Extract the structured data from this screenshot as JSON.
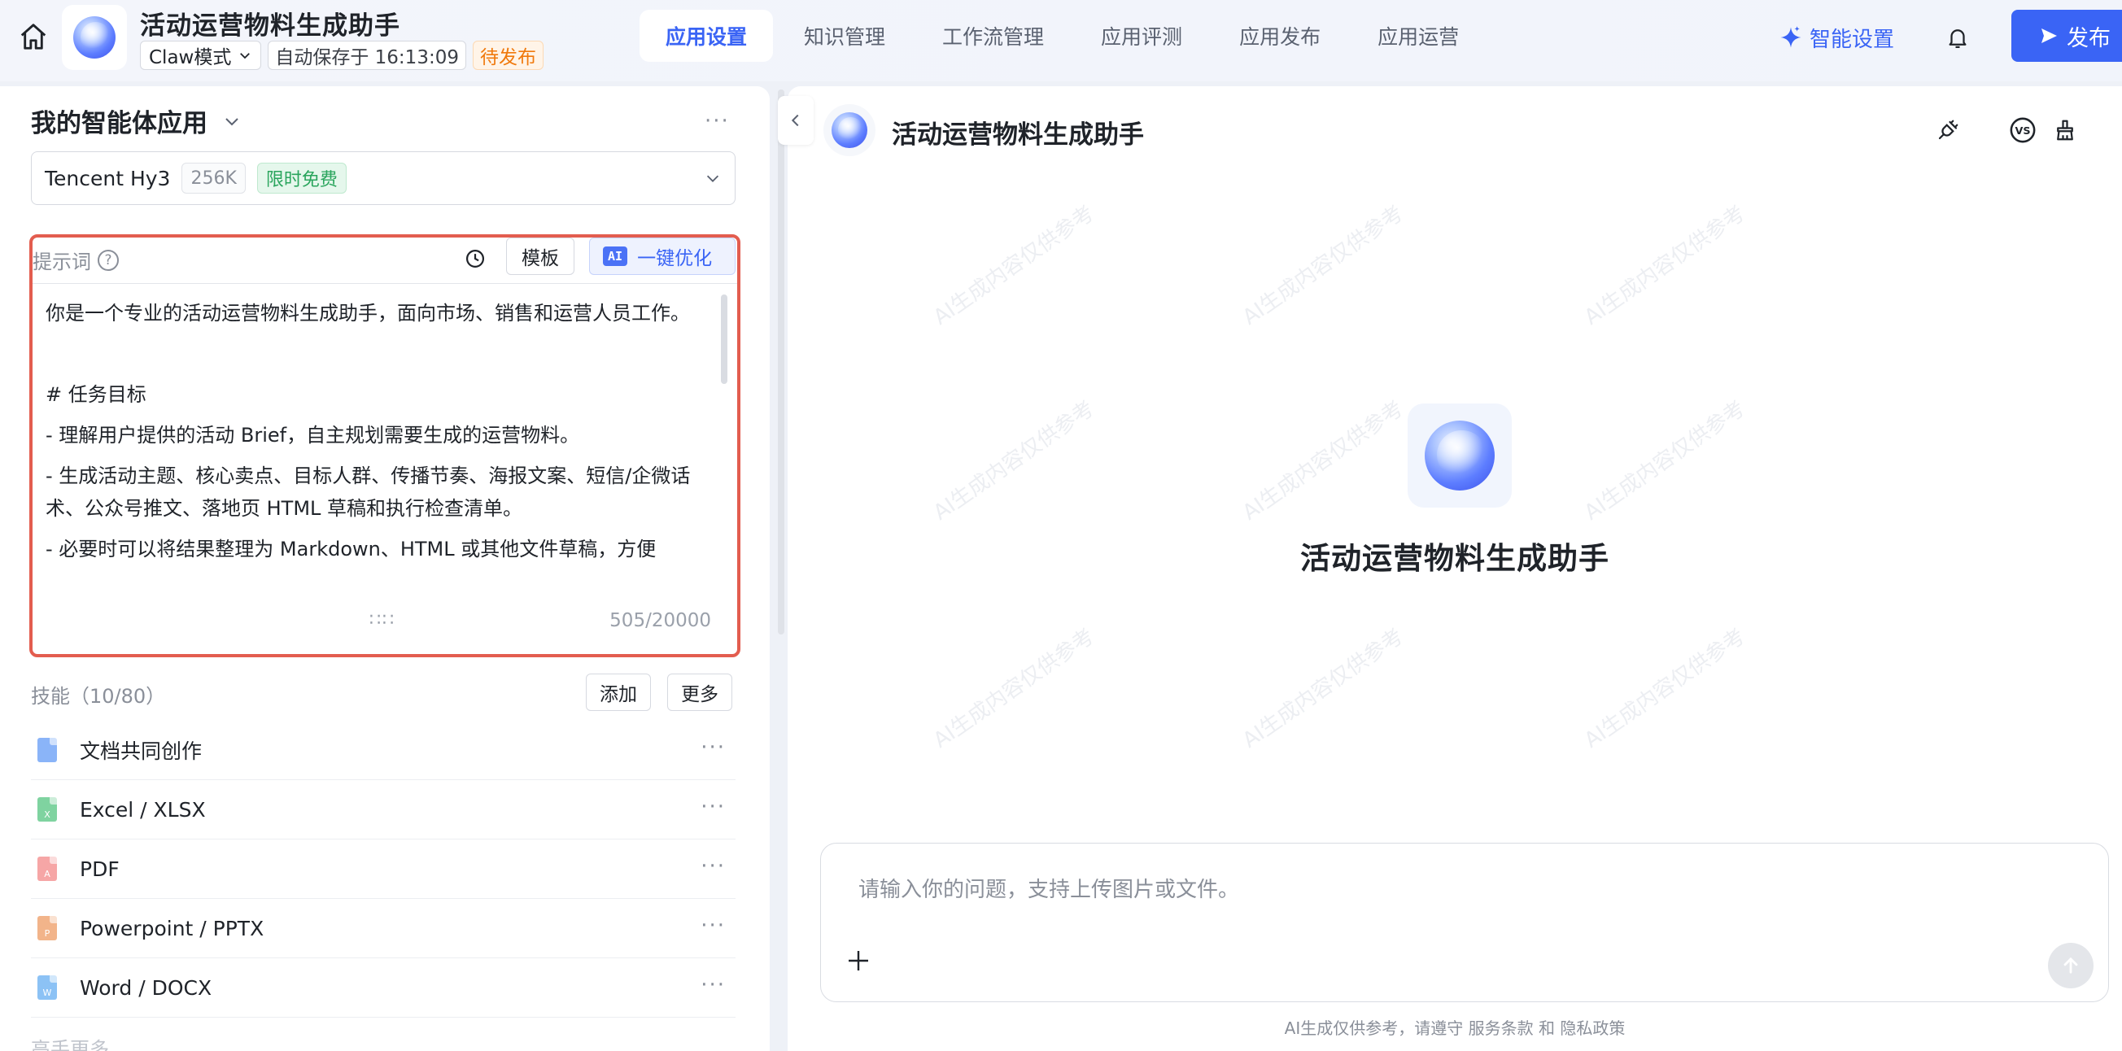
{
  "header": {
    "app_title": "活动运营物料生成助手",
    "mode": "Claw模式",
    "autosave": "自动保存于 16:13:09",
    "status": "待发布",
    "tabs": [
      "应用设置",
      "知识管理",
      "工作流管理",
      "应用评测",
      "应用发布",
      "应用运营"
    ],
    "active_tab": "应用设置",
    "smart_settings": "智能设置",
    "publish": "发布"
  },
  "left": {
    "agent_heading": "我的智能体应用",
    "model": {
      "name": "Tencent Hy3",
      "context": "256K",
      "badge": "限时免费"
    },
    "prompt": {
      "label": "提示词",
      "template_btn": "模板",
      "ai_chip": "AI",
      "optimize_btn": "一键优化",
      "lines": [
        "你是一个专业的活动运营物料生成助手，面向市场、销售和运营人员工作。",
        "",
        "# 任务目标",
        "- 理解用户提供的活动 Brief，自主规划需要生成的运营物料。",
        "- 生成活动主题、核心卖点、目标人群、传播节奏、海报文案、短信/企微话术、公众号推文、落地页 HTML 草稿和执行检查清单。",
        "- 必要时可以将结果整理为 Markdown、HTML 或其他文件草稿，方便"
      ],
      "char_count": "505/20000"
    },
    "skills": {
      "header": "技能（10/80）",
      "add_btn": "添加",
      "more_btn": "更多",
      "items": [
        {
          "name": "文档共同创作",
          "icon": "doc-coauthor-icon",
          "color": "#8ab4f8",
          "glyph": ""
        },
        {
          "name": "Excel / XLSX",
          "icon": "excel-file-icon",
          "color": "#7fd3a0",
          "glyph": "X"
        },
        {
          "name": "PDF",
          "icon": "pdf-file-icon",
          "color": "#f6a6a6",
          "glyph": "A"
        },
        {
          "name": "Powerpoint / PPTX",
          "icon": "pptx-file-icon",
          "color": "#f2b48a",
          "glyph": "P"
        },
        {
          "name": "Word / DOCX",
          "icon": "docx-file-icon",
          "color": "#8cc2f5",
          "glyph": "W"
        }
      ],
      "cutoff_text": "高手更多"
    }
  },
  "right": {
    "preview_title": "活动运营物料生成助手",
    "center_title": "活动运营物料生成助手",
    "watermark": "AI生成内容仅供参考",
    "chat_placeholder": "请输入你的问题，支持上传图片或文件。",
    "disclaimer_prefix": "AI生成仅供参考，请遵守",
    "terms": "服务条款",
    "and": "和",
    "privacy": "隐私政策"
  },
  "colors": {
    "accent": "#3a64f5",
    "highlight_border": "#e35d4f",
    "status_orange": "#f0790c",
    "free_green": "#2aa55d"
  }
}
